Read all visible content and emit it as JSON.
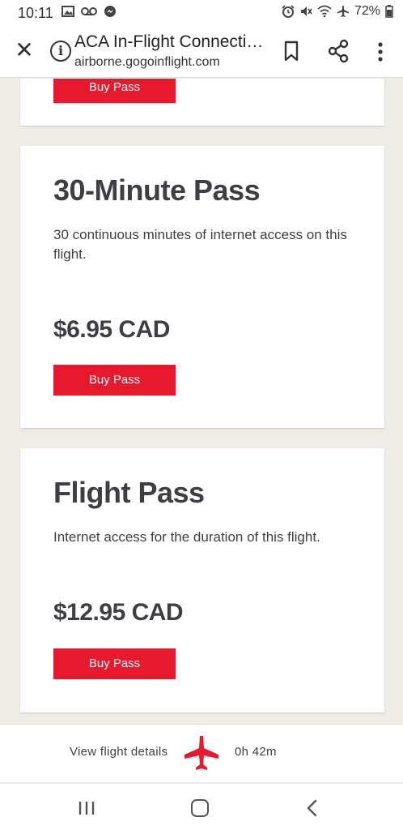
{
  "status_bar": {
    "time": "10:11",
    "battery": "72%",
    "left_icons": [
      "gallery-icon",
      "voicemail-icon",
      "messenger-icon"
    ],
    "right_icons": [
      "alarm-icon",
      "mute-icon",
      "wifi-icon",
      "airplane-mode-icon",
      "battery-icon"
    ]
  },
  "browser": {
    "title": "ACA In-Flight Connecti…",
    "url": "airborne.gogoinflight.com"
  },
  "passes": [
    {
      "buy_label": "Buy Pass"
    },
    {
      "title": "30-Minute Pass",
      "description": "30 continuous minutes of internet access on this flight.",
      "price": "$6.95 CAD",
      "buy_label": "Buy Pass"
    },
    {
      "title": "Flight Pass",
      "description": "Internet access for the duration of this flight.",
      "price": "$12.95 CAD",
      "buy_label": "Buy Pass"
    }
  ],
  "flight_bar": {
    "details_label": "View flight details",
    "duration": "0h 42m"
  },
  "colors": {
    "accent": "#e8192c",
    "text": "#3e3f44",
    "background": "#efece6"
  }
}
